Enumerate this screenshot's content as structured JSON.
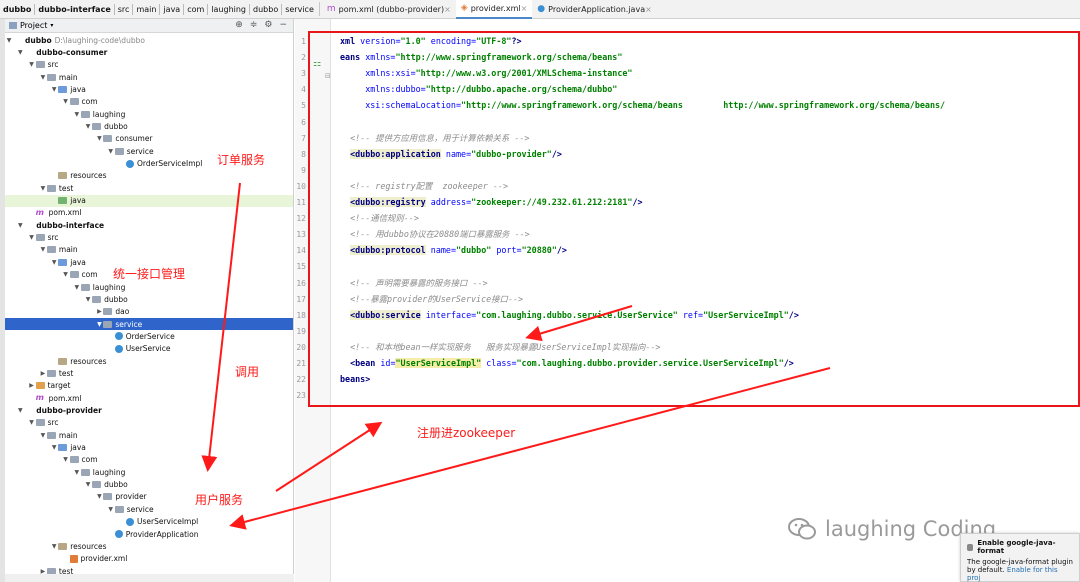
{
  "breadcrumb": [
    "dubbo",
    "dubbo-interface",
    "src",
    "main",
    "java",
    "com",
    "laughing",
    "dubbo",
    "service"
  ],
  "editor_tabs": [
    {
      "label": "pom.xml (dubbo-provider)",
      "icon": "maven-icon",
      "active": false
    },
    {
      "label": "provider.xml",
      "icon": "xml-file-icon",
      "active": true
    },
    {
      "label": "ProviderApplication.java",
      "icon": "class-file-icon",
      "active": false
    }
  ],
  "project_panel": {
    "title": "Project"
  },
  "tree": [
    {
      "label": "dubbo",
      "hint": "D:\\laughing-code\\dubbo",
      "icon": "module",
      "depth": 0,
      "open": true,
      "bold": true
    },
    {
      "label": "dubbo-consumer",
      "icon": "module",
      "depth": 1,
      "open": true,
      "bold": true
    },
    {
      "label": "src",
      "icon": "folder",
      "depth": 2,
      "open": true
    },
    {
      "label": "main",
      "icon": "folder",
      "depth": 3,
      "open": true
    },
    {
      "label": "java",
      "icon": "src",
      "depth": 4,
      "open": true
    },
    {
      "label": "com",
      "icon": "folder",
      "depth": 5,
      "open": true
    },
    {
      "label": "laughing",
      "icon": "folder",
      "depth": 6,
      "open": true
    },
    {
      "label": "dubbo",
      "icon": "folder",
      "depth": 7,
      "open": true
    },
    {
      "label": "consumer",
      "icon": "folder",
      "depth": 8,
      "open": true
    },
    {
      "label": "service",
      "icon": "folder",
      "depth": 9,
      "open": true
    },
    {
      "label": "OrderServiceImpl",
      "icon": "cls",
      "depth": 10
    },
    {
      "label": "resources",
      "icon": "res",
      "depth": 4
    },
    {
      "label": "test",
      "icon": "folder",
      "depth": 3,
      "open": true
    },
    {
      "label": "java",
      "icon": "test",
      "depth": 4,
      "highlight": true
    },
    {
      "label": "pom.xml",
      "icon": "pom",
      "depth": 2
    },
    {
      "label": "dubbo-interface",
      "icon": "module",
      "depth": 1,
      "open": true,
      "bold": true
    },
    {
      "label": "src",
      "icon": "folder",
      "depth": 2,
      "open": true
    },
    {
      "label": "main",
      "icon": "folder",
      "depth": 3,
      "open": true
    },
    {
      "label": "java",
      "icon": "src",
      "depth": 4,
      "open": true
    },
    {
      "label": "com",
      "icon": "folder",
      "depth": 5,
      "open": true
    },
    {
      "label": "laughing",
      "icon": "folder",
      "depth": 6,
      "open": true
    },
    {
      "label": "dubbo",
      "icon": "folder",
      "depth": 7,
      "open": true
    },
    {
      "label": "dao",
      "icon": "folder",
      "depth": 8,
      "closed": true
    },
    {
      "label": "service",
      "icon": "folder",
      "depth": 8,
      "open": true,
      "selected": true
    },
    {
      "label": "OrderService",
      "icon": "cls",
      "depth": 9
    },
    {
      "label": "UserService",
      "icon": "cls",
      "depth": 9
    },
    {
      "label": "resources",
      "icon": "res",
      "depth": 4
    },
    {
      "label": "test",
      "icon": "folder",
      "depth": 3,
      "closed": true
    },
    {
      "label": "target",
      "icon": "tgt",
      "depth": 2,
      "closed": true
    },
    {
      "label": "pom.xml",
      "icon": "pom",
      "depth": 2
    },
    {
      "label": "dubbo-provider",
      "icon": "module",
      "depth": 1,
      "open": true,
      "bold": true
    },
    {
      "label": "src",
      "icon": "folder",
      "depth": 2,
      "open": true
    },
    {
      "label": "main",
      "icon": "folder",
      "depth": 3,
      "open": true
    },
    {
      "label": "java",
      "icon": "src",
      "depth": 4,
      "open": true
    },
    {
      "label": "com",
      "icon": "folder",
      "depth": 5,
      "open": true
    },
    {
      "label": "laughing",
      "icon": "folder",
      "depth": 6,
      "open": true
    },
    {
      "label": "dubbo",
      "icon": "folder",
      "depth": 7,
      "open": true
    },
    {
      "label": "provider",
      "icon": "folder",
      "depth": 8,
      "open": true
    },
    {
      "label": "service",
      "icon": "folder",
      "depth": 9,
      "open": true
    },
    {
      "label": "UserServiceImpl",
      "icon": "cls",
      "depth": 10
    },
    {
      "label": "ProviderApplication",
      "icon": "cls",
      "depth": 9
    },
    {
      "label": "resources",
      "icon": "res",
      "depth": 4,
      "open": true
    },
    {
      "label": "provider.xml",
      "icon": "xml",
      "depth": 5
    },
    {
      "label": "test",
      "icon": "folder",
      "depth": 3,
      "closed": true
    }
  ],
  "line_numbers": [
    "1",
    "2",
    "3",
    "4",
    "5",
    "6",
    "7",
    "8",
    "9",
    "10",
    "11",
    "12",
    "13",
    "14",
    "15",
    "16",
    "17",
    "18",
    "19",
    "20",
    "21",
    "22",
    "23"
  ],
  "code_lines": [
    [
      {
        "c": "t",
        "s": "xml "
      },
      {
        "c": "an",
        "s": "version="
      },
      {
        "c": "av",
        "s": "\"1.0\""
      },
      {
        "c": "an",
        "s": " encoding="
      },
      {
        "c": "av",
        "s": "\"UTF-8\""
      },
      {
        "c": "t",
        "s": "?>"
      }
    ],
    [
      {
        "c": "t",
        "s": "eans "
      },
      {
        "c": "an",
        "s": "xmlns="
      },
      {
        "c": "av",
        "s": "\"http://www.springframework.org/schema/beans\""
      }
    ],
    [
      {
        "c": "",
        "s": "     "
      },
      {
        "c": "an",
        "s": "xmlns:xsi="
      },
      {
        "c": "av",
        "s": "\"http://www.w3.org/2001/XMLSchema-instance\""
      }
    ],
    [
      {
        "c": "",
        "s": "     "
      },
      {
        "c": "an",
        "s": "xmlns:dubbo="
      },
      {
        "c": "av",
        "s": "\"http://dubbo.apache.org/schema/dubbo\""
      }
    ],
    [
      {
        "c": "",
        "s": "     "
      },
      {
        "c": "an",
        "s": "xsi:schemaLocation="
      },
      {
        "c": "av",
        "s": "\"http://www.springframework.org/schema/beans        http://www.springframework.org/schema/beans/"
      }
    ],
    [],
    [
      {
        "c": "cm",
        "s": "  <!-- 提供方应用信息，用于计算依赖关系 -->"
      }
    ],
    [
      {
        "c": "",
        "s": "  "
      },
      {
        "c": "tb",
        "s": "<dubbo:application"
      },
      {
        "c": "an",
        "s": " name="
      },
      {
        "c": "av",
        "s": "\"dubbo-provider\""
      },
      {
        "c": "t",
        "s": "/>"
      }
    ],
    [],
    [
      {
        "c": "cm",
        "s": "  <!-- registry配置  zookeeper -->"
      }
    ],
    [
      {
        "c": "",
        "s": "  "
      },
      {
        "c": "tb",
        "s": "<dubbo:registry"
      },
      {
        "c": "an",
        "s": " address="
      },
      {
        "c": "av",
        "s": "\"zookeeper://49.232.61.212:2181\""
      },
      {
        "c": "t",
        "s": "/>"
      }
    ],
    [
      {
        "c": "cm",
        "s": "  <!--通信规则-->"
      }
    ],
    [
      {
        "c": "cm",
        "s": "  <!-- 用dubbo协议在20880端口暴露服务 -->"
      }
    ],
    [
      {
        "c": "",
        "s": "  "
      },
      {
        "c": "tb",
        "s": "<dubbo:protocol"
      },
      {
        "c": "an",
        "s": " name="
      },
      {
        "c": "av",
        "s": "\"dubbo\""
      },
      {
        "c": "an",
        "s": " port="
      },
      {
        "c": "av",
        "s": "\"20880\""
      },
      {
        "c": "t",
        "s": "/>"
      }
    ],
    [],
    [
      {
        "c": "cm",
        "s": "  <!-- 声明需要暴露的服务接口 -->"
      }
    ],
    [
      {
        "c": "cm",
        "s": "  <!--暴露provider的UserService接口-->"
      }
    ],
    [
      {
        "c": "",
        "s": "  "
      },
      {
        "c": "tb",
        "s": "<dubbo:service"
      },
      {
        "c": "an",
        "s": " interface="
      },
      {
        "c": "av",
        "s": "\"com.laughing.dubbo.service.UserService\""
      },
      {
        "c": "an",
        "s": " ref="
      },
      {
        "c": "av",
        "s": "\"UserServiceImpl\""
      },
      {
        "c": "t",
        "s": "/>"
      }
    ],
    [],
    [
      {
        "c": "cm",
        "s": "  <!-- 和本地bean一样实现服务   服务实现暴露UserServiceImpl实现指向-->"
      }
    ],
    [
      {
        "c": "",
        "s": "  "
      },
      {
        "c": "t",
        "s": "<bean"
      },
      {
        "c": "an",
        "s": " id="
      },
      {
        "c": "av hl",
        "s": "\"UserServiceImpl\""
      },
      {
        "c": "an",
        "s": " class="
      },
      {
        "c": "av",
        "s": "\"com.laughing.dubbo.provider.service.UserServiceImpl\""
      },
      {
        "c": "t",
        "s": "/>"
      }
    ],
    [
      {
        "c": "t",
        "s": "beans>"
      }
    ],
    []
  ],
  "annotations": {
    "order_service": "订单服务",
    "interface_mgmt": "统一接口管理",
    "invoke": "调用",
    "user_service": "用户服务",
    "register_zk": "注册进zookeeper"
  },
  "annotation_color": "#ff1a1a",
  "watermark": "laughing Coding",
  "notification": {
    "title": "Enable google-java-format",
    "body": "The google-java-format plugin",
    "body2_prefix": "by default. ",
    "link": "Enable for this proj"
  }
}
